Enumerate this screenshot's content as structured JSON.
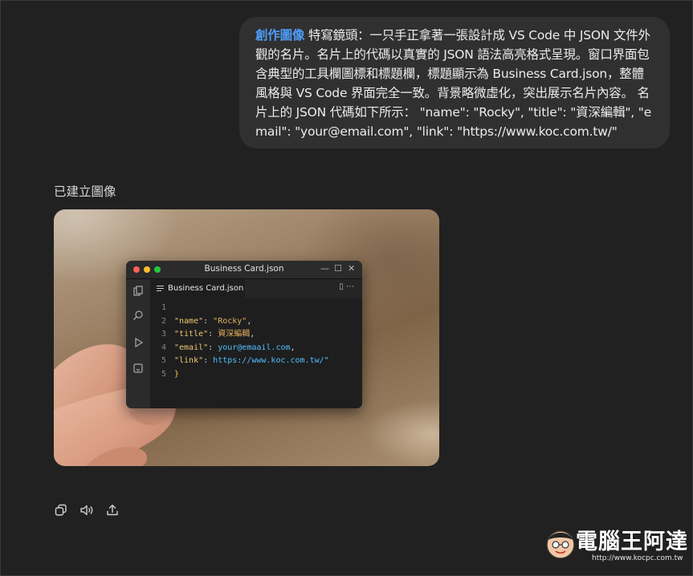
{
  "user_message": {
    "tool_tag": "創作圖像",
    "text": " 特寫鏡頭：一只手正拿著一張設計成 VS Code 中 JSON 文件外觀的名片。名片上的代碼以真實的 JSON 語法高亮格式呈現。窗口界面包含典型的工具欄圖標和標題欄，標題顯示為 Business Card.json，整體風格與 VS Code 界面完全一致。背景略微虛化，突出展示名片內容。 名片上的 JSON 代碼如下所示： \"name\": \"Rocky\", \"title\": \"資深編輯\", \"email\": \"your@email.com\", \"link\": \"https://www.koc.com.tw/\""
  },
  "caption": "已建立圖像",
  "vscode": {
    "window_title": "Business Card.json",
    "tab_label": "Business Card.json",
    "tab_actions": "▯ ⋯",
    "lines": [
      {
        "num": "1",
        "key": "",
        "value": "",
        "tail": ""
      },
      {
        "num": "2",
        "key": "\"name\"",
        "value": "\"Rocky\"",
        "tail": ","
      },
      {
        "num": "3",
        "key": "\"title\"",
        "value": "資深編輯",
        "tail": ","
      },
      {
        "num": "4",
        "key": "\"email\"",
        "value": "your@emaail.com",
        "tail": ","
      },
      {
        "num": "5",
        "key": "\"link\"",
        "value": "https://www.koc.com.tw/\"",
        "tail": ""
      },
      {
        "num": "5",
        "key": "",
        "value": "}",
        "tail": ""
      }
    ]
  },
  "action_icons": [
    "copy-icon",
    "speaker-icon",
    "share-icon"
  ],
  "watermark": {
    "title": "電腦王阿達",
    "url": "http://www.kocpc.com.tw"
  },
  "colors": {
    "background": "#212121",
    "bubble": "#303030",
    "accent": "#4f9cf9"
  }
}
